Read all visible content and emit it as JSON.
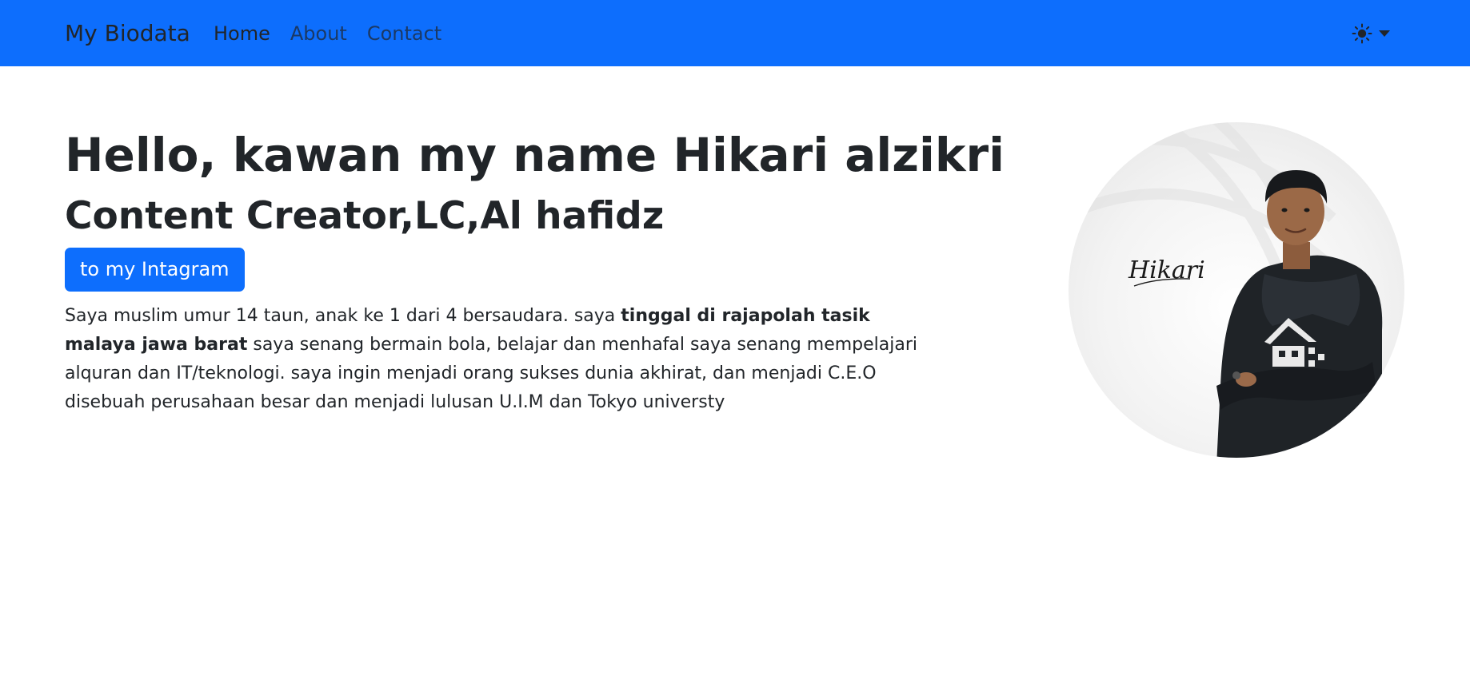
{
  "navbar": {
    "brand": "My Biodata",
    "links": [
      {
        "label": "Home",
        "active": true
      },
      {
        "label": "About",
        "active": false
      },
      {
        "label": "Contact",
        "active": false
      }
    ],
    "theme_icon": "sun-icon",
    "accent_color": "#0d6efd"
  },
  "hero": {
    "title": "Hello, kawan my name Hikari alzikri",
    "subtitle": "Content Creator,LC,Al hafidz",
    "button_label": "to my Intagram",
    "bio": {
      "part1": "Saya muslim umur 14 taun, anak ke 1 dari 4 bersaudara. saya ",
      "bold": "tinggal di rajapolah tasik malaya jawa barat",
      "part2": " saya senang bermain bola, belajar dan menhafal saya senang mempelajari alquran dan IT/teknologi. saya ingin menjadi orang sukses dunia akhirat, dan menjadi C.E.O disebuah perusahaan besar dan menjadi lulusan U.I.M dan Tokyo universty"
    },
    "avatar": {
      "signature": "Hikari"
    }
  }
}
